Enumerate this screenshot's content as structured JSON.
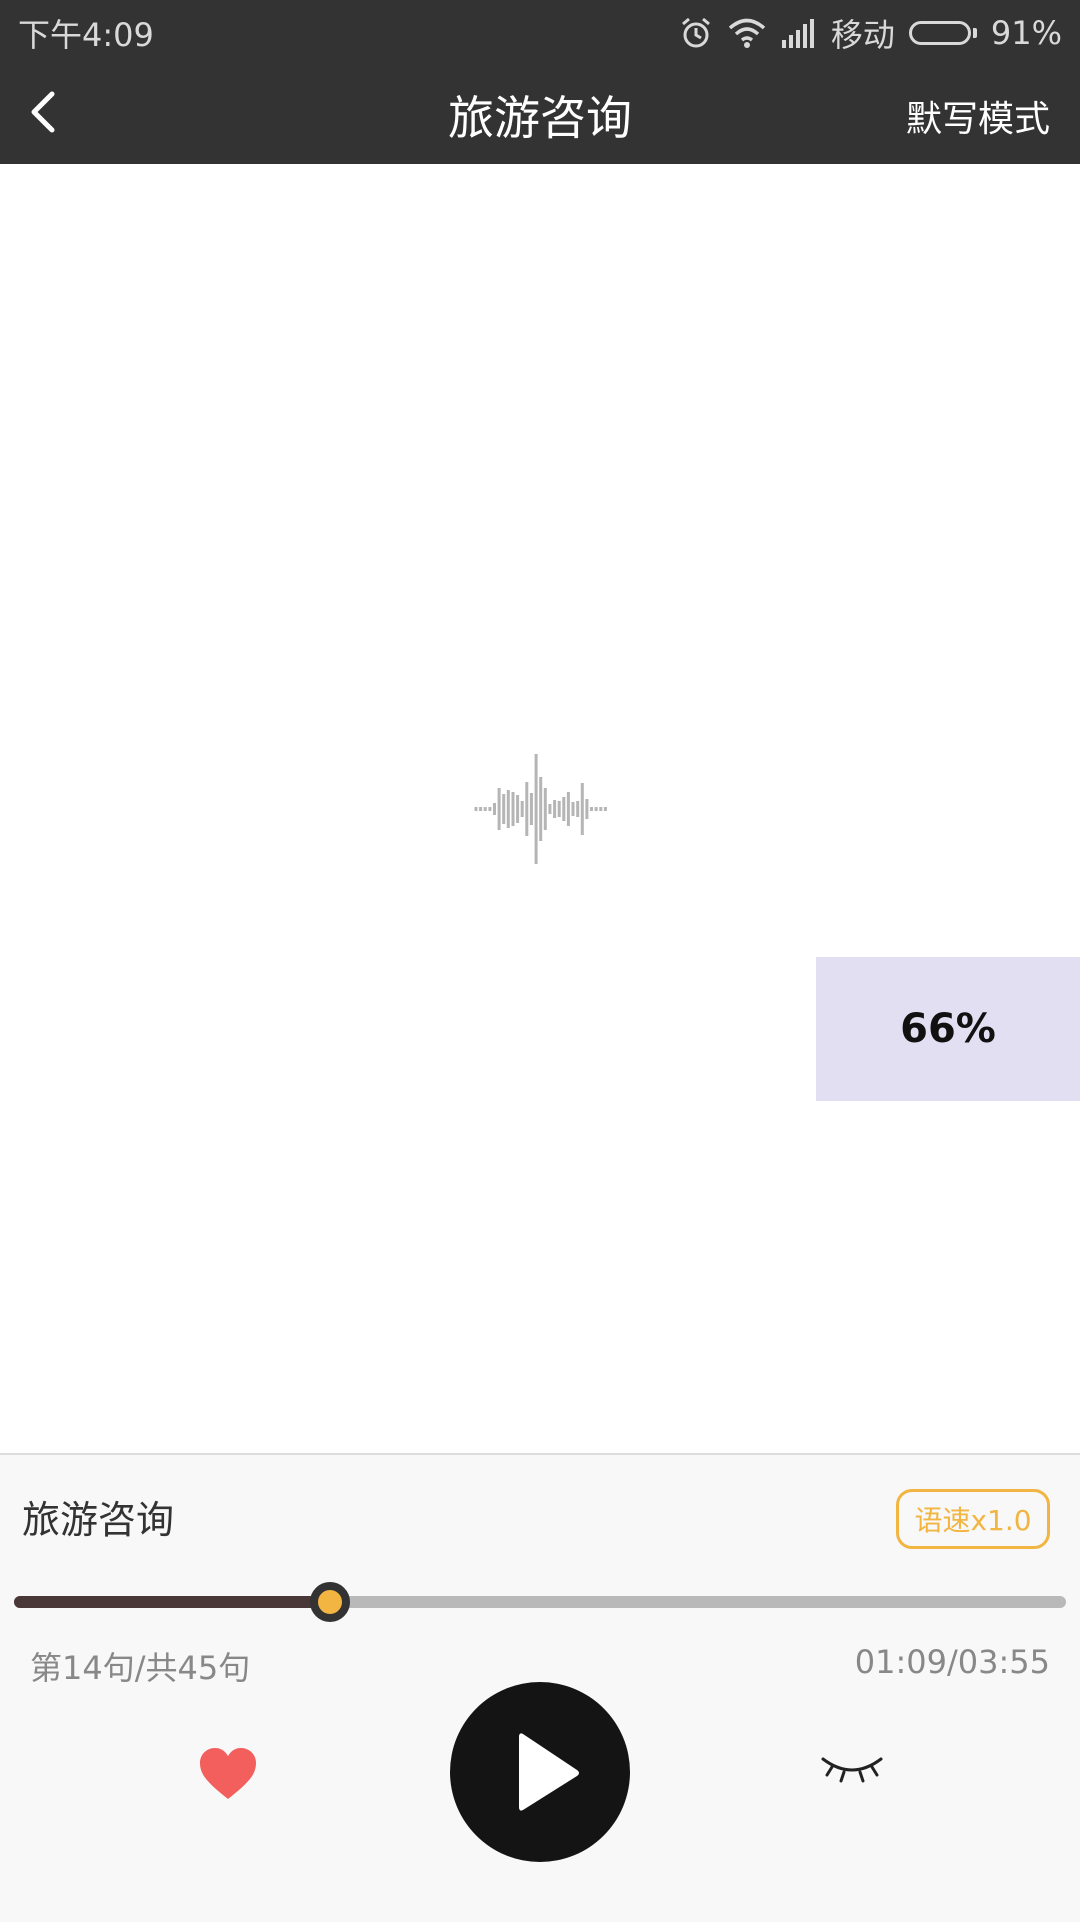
{
  "status_bar": {
    "time": "下午4:09",
    "carrier": "移动",
    "battery": "91%",
    "battery_level": 0.91
  },
  "app_bar": {
    "back_icon": "chevron-left-icon",
    "title": "旅游咨询",
    "mode_button": "默写模式"
  },
  "center": {
    "icon": "waveform-icon"
  },
  "overlay": {
    "percent": "66%"
  },
  "player": {
    "track_title": "旅游咨询",
    "speed_button": "语速x1.0",
    "progress_fraction": 0.3,
    "sentence_count": "第14句/共45句",
    "time": "01:09/03:55",
    "favorite_icon": "heart-icon",
    "play_icon": "play-icon",
    "eye_icon": "eye-closed-icon"
  },
  "colors": {
    "bar_background": "#333333",
    "accent": "#f2b541",
    "heart": "#f25f5c",
    "progress_fill": "#4a3838"
  }
}
